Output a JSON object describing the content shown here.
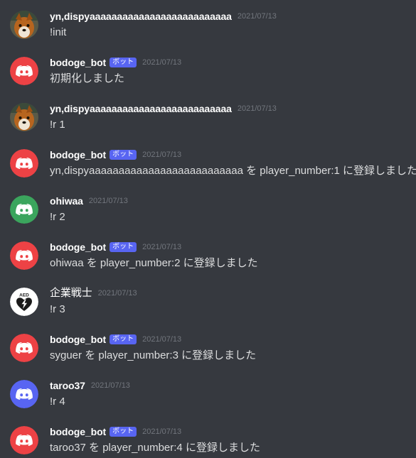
{
  "colors": {
    "background": "#36393f",
    "discord_red": "#ed4245",
    "discord_green": "#3ba55d",
    "discord_blurple": "#5865f2",
    "bot_tag": "#5865f2",
    "timestamp": "#72767d",
    "username": "#ffffff",
    "text": "#dcddde"
  },
  "messages": [
    {
      "username": "yn,dispyaaaaaaaaaaaaaaaaaaaaaaaaaa",
      "bot_tag": "",
      "timestamp": "2021/07/13",
      "content": "!init",
      "avatar": "dog-photo-avatar"
    },
    {
      "username": "bodoge_bot",
      "bot_tag": "ボット",
      "timestamp": "2021/07/13",
      "content": "初期化しました",
      "avatar": "discord-logo-red"
    },
    {
      "username": "yn,dispyaaaaaaaaaaaaaaaaaaaaaaaaaa",
      "bot_tag": "",
      "timestamp": "2021/07/13",
      "content": "!r 1",
      "avatar": "dog-photo-avatar"
    },
    {
      "username": "bodoge_bot",
      "bot_tag": "ボット",
      "timestamp": "2021/07/13",
      "content": "yn,dispyaaaaaaaaaaaaaaaaaaaaaaaaaa を player_number:1 に登録しました",
      "avatar": "discord-logo-red"
    },
    {
      "username": "ohiwaa",
      "bot_tag": "",
      "timestamp": "2021/07/13",
      "content": "!r 2",
      "avatar": "discord-logo-green"
    },
    {
      "username": "bodoge_bot",
      "bot_tag": "ボット",
      "timestamp": "2021/07/13",
      "content": "ohiwaa を player_number:2 に登録しました",
      "avatar": "discord-logo-red"
    },
    {
      "username": "企業戦士",
      "bot_tag": "",
      "timestamp": "2021/07/13",
      "content": "!r 3",
      "avatar": "aed-heart-avatar",
      "avatar_text": "AED"
    },
    {
      "username": "bodoge_bot",
      "bot_tag": "ボット",
      "timestamp": "2021/07/13",
      "content": "syguer を player_number:3 に登録しました",
      "avatar": "discord-logo-red"
    },
    {
      "username": "taroo37",
      "bot_tag": "",
      "timestamp": "2021/07/13",
      "content": "!r 4",
      "avatar": "discord-logo-blurple"
    },
    {
      "username": "bodoge_bot",
      "bot_tag": "ボット",
      "timestamp": "2021/07/13",
      "content": "taroo37 を player_number:4 に登録しました",
      "avatar": "discord-logo-red"
    }
  ]
}
